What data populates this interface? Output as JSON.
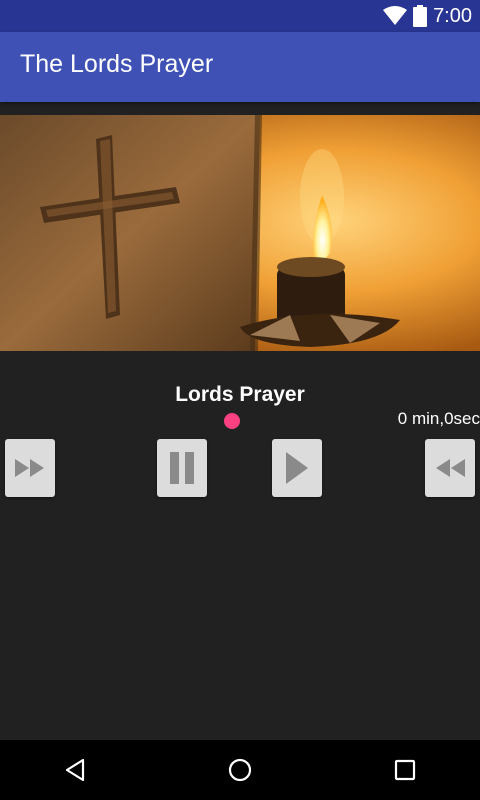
{
  "status_bar": {
    "time": "7:00",
    "icons": [
      "wifi-icon",
      "battery-icon"
    ]
  },
  "app_bar": {
    "title": "The Lords Prayer"
  },
  "hero_image": {
    "description": "cross-and-candle"
  },
  "player": {
    "track_title": "Lords Prayer",
    "time_label": "0 min,0sec",
    "progress": 0,
    "buttons": [
      "fast-forward",
      "pause",
      "play",
      "rewind"
    ],
    "accent": "#ff4081"
  },
  "colors": {
    "primary": "#3f51b5",
    "primary_dark": "#293593",
    "background": "#212121"
  },
  "nav_bar": {
    "buttons": [
      "back",
      "home",
      "recents"
    ]
  }
}
